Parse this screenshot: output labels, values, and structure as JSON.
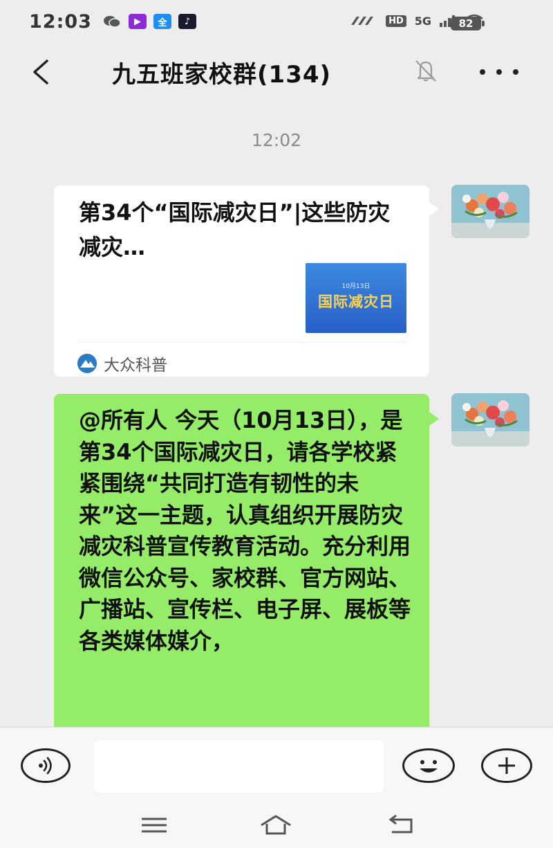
{
  "status_bar": {
    "time": "12:03",
    "signal_label": "5G",
    "hd_label": "HD",
    "battery": "82"
  },
  "header": {
    "title": "九五班家校群(134)"
  },
  "chat": {
    "timestamp": "12:02",
    "messages": [
      {
        "type": "article",
        "title": "第34个“国际减灾日”|这些防灾减灾…",
        "thumbnail_date": "10月13日",
        "thumbnail_text": "国际减灾日",
        "source": "大众科普"
      },
      {
        "type": "text",
        "text": "@所有人 今天（10月13日），是第34个国际减灾日，请各学校紧紧围绕“共同打造有韧性的未来”这一主题，认真组织开展防灾减灾科普宣传教育活动。充分利用微信公众号、家校群、官方网站、广播站、宣传栏、电子屏、展板等各类媒体媒介，"
      }
    ]
  },
  "input_bar": {
    "placeholder": ""
  },
  "colors": {
    "background": "#ededed",
    "sent_bubble": "#95ec69",
    "card": "#ffffff",
    "timestamp": "#8a8a8a"
  },
  "icons": [
    "back-icon",
    "mute-bell-icon",
    "more-icon",
    "voice-icon",
    "emoji-icon",
    "plus-icon",
    "menu-icon",
    "home-icon",
    "return-icon"
  ]
}
